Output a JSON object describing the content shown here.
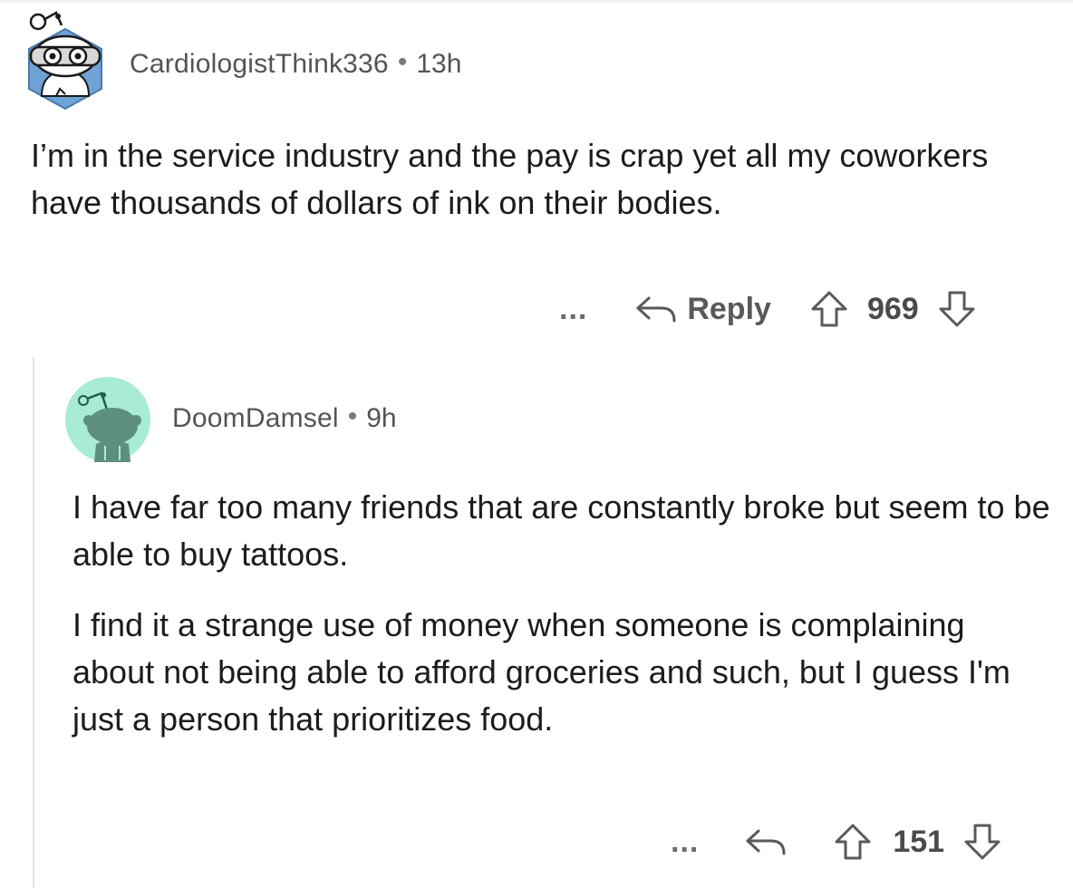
{
  "comments": [
    {
      "username": "CardiologistThink336",
      "separator": "•",
      "time": "13h",
      "paragraphs": [
        "I’m in the service industry and the pay is crap yet all my coworkers have thousands of dollars of ink on their bodies."
      ],
      "more_label": "...",
      "reply_label": "Reply",
      "votes": "969",
      "avatar_color": "#6fa3d6"
    },
    {
      "username": "DoomDamsel",
      "separator": "•",
      "time": "9h",
      "paragraphs": [
        "I have far too many friends that are constantly broke but seem to be able to buy tattoos.",
        "I find it a strange use of money when someone is complaining about not being able to afford groceries and such, but I guess I'm just a person that prioritizes food."
      ],
      "more_label": "...",
      "votes": "151",
      "avatar_color": "#a7ecd3"
    }
  ],
  "icons": {
    "reply": "reply-arrow-icon",
    "upvote": "upvote-arrow-icon",
    "downvote": "downvote-arrow-icon"
  }
}
